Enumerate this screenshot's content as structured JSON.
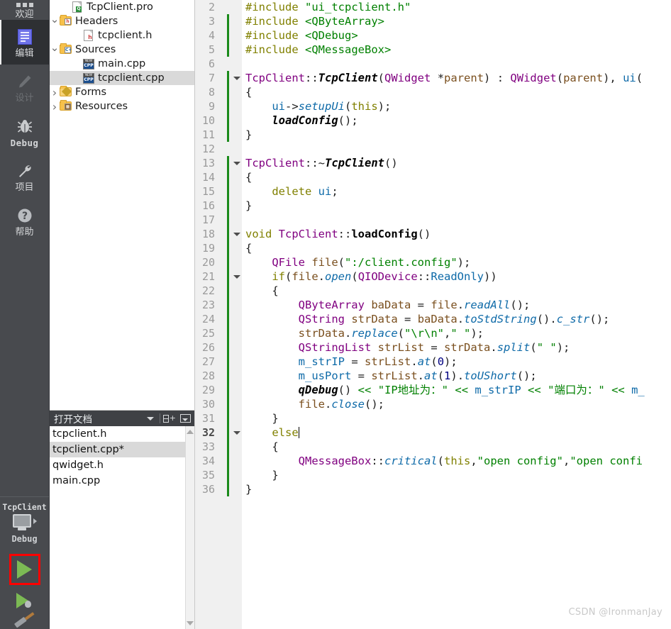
{
  "mode_bar": {
    "items": [
      {
        "label": "欢迎",
        "icon": "grid-icon",
        "state": "normal"
      },
      {
        "label": "编辑",
        "icon": "edit-document-icon",
        "state": "active"
      },
      {
        "label": "设计",
        "icon": "pencil-icon",
        "state": "disabled"
      },
      {
        "label": "Debug",
        "icon": "bug-icon",
        "state": "normal"
      },
      {
        "label": "项目",
        "icon": "wrench-icon",
        "state": "normal"
      },
      {
        "label": "帮助",
        "icon": "question-circle-icon",
        "state": "normal"
      }
    ],
    "kit": {
      "project_name": "TcpClient",
      "target_icon": "monitor-icon",
      "expand_icon": "triangle-right-icon",
      "build_config": "Debug",
      "run_button_icon": "play-triangle-icon",
      "debug_button_icon": "play-bug-icon",
      "build_button_icon": "hammer-icon"
    }
  },
  "project_tree": {
    "rows": [
      {
        "label": "TcpClient.pro",
        "icon": "pro-file-icon",
        "indent": 2,
        "arrow": "none",
        "selected": false
      },
      {
        "label": "Headers",
        "icon": "folder-h-icon",
        "indent": 1,
        "arrow": "expanded",
        "selected": false
      },
      {
        "label": "tcpclient.h",
        "icon": "h-file-icon",
        "indent": 3,
        "arrow": "none",
        "selected": false
      },
      {
        "label": "Sources",
        "icon": "folder-cpp-icon",
        "indent": 1,
        "arrow": "expanded",
        "selected": false
      },
      {
        "label": "main.cpp",
        "icon": "cpp-file-icon",
        "indent": 3,
        "arrow": "none",
        "selected": false
      },
      {
        "label": "tcpclient.cpp",
        "icon": "cpp-file-icon",
        "indent": 3,
        "arrow": "none",
        "selected": true
      },
      {
        "label": "Forms",
        "icon": "folder-forms-icon",
        "indent": 1,
        "arrow": "collapsed",
        "selected": false
      },
      {
        "label": "Resources",
        "icon": "folder-res-icon",
        "indent": 1,
        "arrow": "collapsed",
        "selected": false
      }
    ]
  },
  "open_documents": {
    "title": "打开文档",
    "header_buttons": [
      {
        "name": "dropdown-chevron",
        "icon": "chevron-down-icon"
      },
      {
        "name": "split-add",
        "icon": "split-plus-icon"
      },
      {
        "name": "close-panel",
        "icon": "collapse-box-icon"
      }
    ],
    "files": [
      {
        "label": "main.cpp",
        "selected": false
      },
      {
        "label": "qwidget.h",
        "selected": false
      },
      {
        "label": "tcpclient.cpp*",
        "selected": true
      },
      {
        "label": "tcpclient.h",
        "selected": false
      }
    ],
    "scrollbar": {
      "up_icon": "triangle-up-icon",
      "down_icon": "triangle-down-icon"
    }
  },
  "editor": {
    "current_line": 32,
    "first_visible_line": 2,
    "line_numbers": [
      2,
      3,
      4,
      5,
      6,
      7,
      8,
      9,
      10,
      11,
      12,
      13,
      14,
      15,
      16,
      17,
      18,
      19,
      20,
      21,
      22,
      23,
      24,
      25,
      26,
      27,
      28,
      29,
      30,
      31,
      32,
      33,
      34,
      35,
      36
    ],
    "fold_markers": [
      7,
      13,
      18,
      21,
      32
    ],
    "lines": [
      {
        "n": 2,
        "html": "<span class='pre'>#include</span> <span class='str'>\"ui_tcpclient.h\"</span>"
      },
      {
        "n": 3,
        "html": "<span class='pre'>#include</span> <span class='str'>&lt;QByteArray&gt;</span>"
      },
      {
        "n": 4,
        "html": "<span class='pre'>#include</span> <span class='str'>&lt;QDebug&gt;</span>"
      },
      {
        "n": 5,
        "html": "<span class='pre'>#include</span> <span class='str'>&lt;QMessageBox&gt;</span>"
      },
      {
        "n": 6,
        "html": ""
      },
      {
        "n": 7,
        "html": "<span class='typ'>TcpClient</span><span class='op'>::</span><span class='fnb'>TcpClient</span><span class='op'>(</span><span class='typ'>QWidget</span> <span class='op'>*</span><span class='loc'>parent</span><span class='op'>)</span> <span class='op'>:</span> <span class='typ'>QWidget</span><span class='op'>(</span><span class='loc'>parent</span><span class='op'>),</span> <span class='mem'>ui</span><span class='op'>(</span>"
      },
      {
        "n": 8,
        "html": "<span class='op'>{</span>"
      },
      {
        "n": 9,
        "html": "    <span class='mem'>ui</span><span class='op'>-&gt;</span><span class='memi'>setupUi</span><span class='op'>(</span><span class='k'>this</span><span class='op'>);</span>"
      },
      {
        "n": 10,
        "html": "    <span class='fnb'>loadConfig</span><span class='op'>();</span>"
      },
      {
        "n": 11,
        "html": "<span class='op'>}</span>"
      },
      {
        "n": 12,
        "html": ""
      },
      {
        "n": 13,
        "html": "<span class='typ'>TcpClient</span><span class='op'>::~</span><span class='fnb'>TcpClient</span><span class='op'>()</span>"
      },
      {
        "n": 14,
        "html": "<span class='op'>{</span>"
      },
      {
        "n": 15,
        "html": "    <span class='k'>delete</span> <span class='mem'>ui</span><span class='op'>;</span>"
      },
      {
        "n": 16,
        "html": "<span class='op'>}</span>"
      },
      {
        "n": 17,
        "html": ""
      },
      {
        "n": 18,
        "html": "<span class='k'>void</span> <span class='typ'>TcpClient</span><span class='op'>::</span><span class='fn'>loadConfig</span><span class='op'>()</span>"
      },
      {
        "n": 19,
        "html": "<span class='op'>{</span>"
      },
      {
        "n": 20,
        "html": "    <span class='typ'>QFile</span> <span class='loc'>file</span><span class='op'>(</span><span class='str'>\":/client.config\"</span><span class='op'>);</span>"
      },
      {
        "n": 21,
        "html": "    <span class='k'>if</span><span class='op'>(</span><span class='loc'>file</span><span class='op'>.</span><span class='memi'>open</span><span class='op'>(</span><span class='typ'>QIODevice</span><span class='op'>::</span><span class='mem'>ReadOnly</span><span class='op'>))</span>"
      },
      {
        "n": 22,
        "html": "    <span class='op'>{</span>"
      },
      {
        "n": 23,
        "html": "        <span class='typ'>QByteArray</span> <span class='loc'>baData</span> <span class='op'>=</span> <span class='loc'>file</span><span class='op'>.</span><span class='memi'>readAll</span><span class='op'>();</span>"
      },
      {
        "n": 24,
        "html": "        <span class='typ'>QString</span> <span class='loc'>strData</span> <span class='op'>=</span> <span class='loc'>baData</span><span class='op'>.</span><span class='memi'>toStdString</span><span class='op'>().</span><span class='memi'>c_str</span><span class='op'>();</span>"
      },
      {
        "n": 25,
        "html": "        <span class='loc'>strData</span><span class='op'>.</span><span class='memi'>replace</span><span class='op'>(</span><span class='str'>\"\\r\\n\"</span><span class='op'>,</span><span class='str'>\" \"</span><span class='op'>);</span>"
      },
      {
        "n": 26,
        "html": "        <span class='typ'>QStringList</span> <span class='loc'>strList</span> <span class='op'>=</span> <span class='loc'>strData</span><span class='op'>.</span><span class='memi'>split</span><span class='op'>(</span><span class='str'>\" \"</span><span class='op'>);</span>"
      },
      {
        "n": 27,
        "html": "        <span class='mem'>m_strIP</span> <span class='op'>=</span> <span class='loc'>strList</span><span class='op'>.</span><span class='memi'>at</span><span class='op'>(</span><span class='num'>0</span><span class='op'>);</span>"
      },
      {
        "n": 28,
        "html": "        <span class='mem'>m_usPort</span> <span class='op'>=</span> <span class='loc'>strList</span><span class='op'>.</span><span class='memi'>at</span><span class='op'>(</span><span class='num'>1</span><span class='op'>).</span><span class='memi'>toUShort</span><span class='op'>();</span>"
      },
      {
        "n": 29,
        "html": "        <span class='fnb'>qDebug</span><span class='op'>()</span> <span class='str'>&lt;&lt;</span> <span class='str'>\"IP地址为：\"</span> <span class='str'>&lt;&lt;</span> <span class='mem'>m_strIP</span> <span class='str'>&lt;&lt;</span> <span class='str'>\"端口为：\"</span> <span class='str'>&lt;&lt;</span> <span class='mem'>m_</span>"
      },
      {
        "n": 30,
        "html": "        <span class='loc'>file</span><span class='op'>.</span><span class='memi'>close</span><span class='op'>();</span>"
      },
      {
        "n": 31,
        "html": "    <span class='op'>}</span>"
      },
      {
        "n": 32,
        "html": "    <span class='k'>else</span><span class='caret-here'></span>"
      },
      {
        "n": 33,
        "html": "    <span class='op'>{</span>"
      },
      {
        "n": 34,
        "html": "        <span class='typ'>QMessageBox</span><span class='op'>::</span><span class='memi'>critical</span><span class='op'>(</span><span class='k'>this</span><span class='op'>,</span><span class='str'>\"open config\"</span><span class='op'>,</span><span class='str'>\"open confi</span>"
      },
      {
        "n": 35,
        "html": "    <span class='op'>}</span>"
      },
      {
        "n": 36,
        "html": "<span class='op'>}</span>"
      }
    ]
  },
  "watermark": "CSDN @IronmanJay",
  "colors": {
    "mode_bar_bg": "#484a4e",
    "mode_active_bg": "#2e3033",
    "gutter_bg": "#f0f0f0",
    "modification_marker": "#1a8a1a",
    "run_highlight": "#ff0000",
    "run_green": "#7cba54",
    "selection_bg": "#d9d9d9",
    "string": "#008000",
    "type": "#800080",
    "member": "#0e6aa8",
    "keyword": "#808000"
  }
}
